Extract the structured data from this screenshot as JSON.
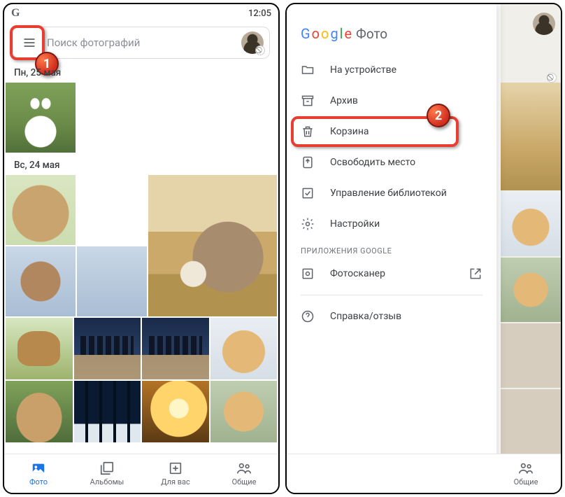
{
  "status": {
    "g": "G",
    "time": "12:05"
  },
  "search": {
    "placeholder": "Поиск фотографий"
  },
  "callouts": {
    "one": "1",
    "two": "2"
  },
  "sections": {
    "day1": "Пн, 25 мая",
    "day2": "Вс, 24 мая"
  },
  "nav": {
    "photos": "Фото",
    "albums": "Альбомы",
    "foryou": "Для вас",
    "shared": "Общие"
  },
  "drawer": {
    "brand_suffix": "Фото",
    "items": {
      "device": "На устройстве",
      "archive": "Архив",
      "trash": "Корзина",
      "freeup": "Освободить место",
      "library": "Управление библиотекой",
      "settings": "Настройки"
    },
    "section_label": "ПРИЛОЖЕНИЯ GOOGLE",
    "scanner": "Фотосканер",
    "help": "Справка/отзыв"
  }
}
